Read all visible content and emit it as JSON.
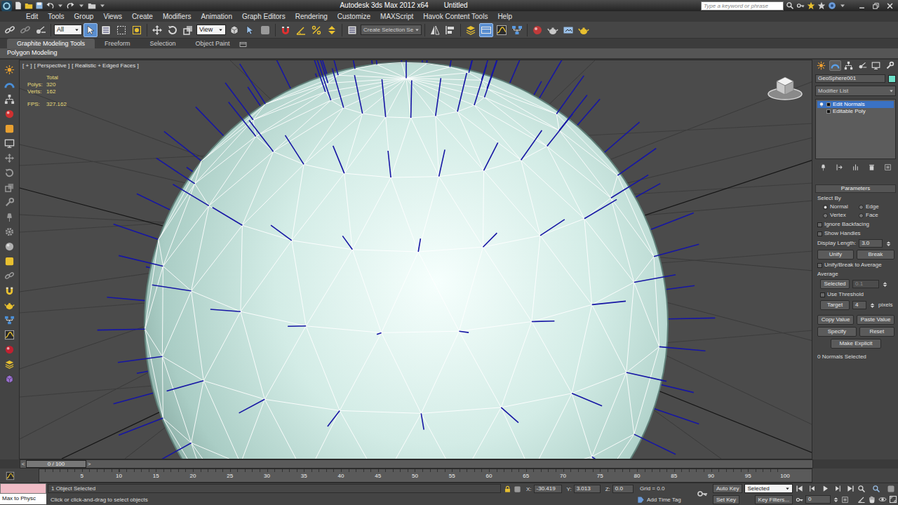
{
  "window": {
    "title": "Autodesk 3ds Max 2012 x64",
    "document": "Untitled",
    "search_placeholder": "Type a keyword or phrase"
  },
  "menu": [
    "Edit",
    "Tools",
    "Group",
    "Views",
    "Create",
    "Modifiers",
    "Animation",
    "Graph Editors",
    "Rendering",
    "Customize",
    "MAXScript",
    "Havok Content Tools",
    "Help"
  ],
  "toolbar": {
    "selection_filter": "All",
    "reference_coord": "View",
    "named_selection": "Create Selection Se",
    "select_active": true,
    "ribbon_toggle_active": true
  },
  "ribbon": {
    "tabs": [
      {
        "label": "Graphite Modeling Tools",
        "selected": true
      },
      {
        "label": "Freeform",
        "selected": false
      },
      {
        "label": "Selection",
        "selected": false
      },
      {
        "label": "Object Paint",
        "selected": false
      }
    ],
    "panel": "Polygon Modeling"
  },
  "viewport": {
    "labels": [
      "[ + ]",
      "[ Perspective ]",
      "[ Realistic + Edged Faces ]"
    ],
    "stats": {
      "header": "Total",
      "rows": [
        {
          "label": "Polys:",
          "value": "320"
        },
        {
          "label": "Verts:",
          "value": "162"
        }
      ],
      "fps_label": "FPS:",
      "fps_value": "327.162"
    }
  },
  "command_panel": {
    "modify_tab_active": true,
    "object_name": "GeoSphere001",
    "modifier_list": "Modifier List",
    "stack": [
      {
        "label": "Edit Normals",
        "selected": true,
        "kind": "modifier"
      },
      {
        "label": "Editable Poly",
        "selected": false,
        "kind": "base"
      }
    ],
    "rollout": "Parameters",
    "select_by": {
      "label": "Select By",
      "options": [
        {
          "label": "Normal",
          "selected": true
        },
        {
          "label": "Edge",
          "selected": false
        },
        {
          "label": "Vertex",
          "selected": false
        },
        {
          "label": "Face",
          "selected": false
        }
      ]
    },
    "ignore_backfacing": {
      "label": "Ignore Backfacing",
      "checked": false
    },
    "show_handles": {
      "label": "Show Handles",
      "checked": false
    },
    "display_length": {
      "label": "Display Length:",
      "value": "3.0"
    },
    "unify": "Unify",
    "break": "Break",
    "unify_break_average": {
      "label": "Unify/Break to Average",
      "checked": false
    },
    "average": {
      "label": "Average",
      "selected_button": "Selected",
      "selected_value": "0.1",
      "selected_value_disabled": true,
      "use_threshold": {
        "label": "Use Threshold",
        "checked": false
      },
      "target_button": "Target",
      "target_value": "4",
      "target_unit": "pixels"
    },
    "copy_value": "Copy Value",
    "paste_value": "Paste Value",
    "specify": "Specify",
    "reset": "Reset",
    "make_explicit": "Make Explicit",
    "status": "0 Normals Selected"
  },
  "timeline": {
    "prev": "<",
    "position": "0 / 100",
    "next": ">",
    "ticks": [
      "5",
      "10",
      "15",
      "20",
      "25",
      "30",
      "35",
      "40",
      "45",
      "50",
      "55",
      "60",
      "65",
      "70",
      "75",
      "80",
      "85",
      "90",
      "95",
      "100"
    ]
  },
  "status_bar": {
    "maxscript": "Max to Physc",
    "selection": "1 Object Selected",
    "prompt": "Click or click-and-drag to select objects",
    "x_label": "X:",
    "x": "-30.419",
    "y_label": "Y:",
    "y": "3.013",
    "z_label": "Z:",
    "z": "0.0",
    "grid": "Grid = 0.0",
    "add_time_tag": "Add Time Tag",
    "auto_key": "Auto Key",
    "key_mode": "Selected",
    "set_key": "Set Key",
    "key_filters": "Key Filters...",
    "frame": "0"
  }
}
